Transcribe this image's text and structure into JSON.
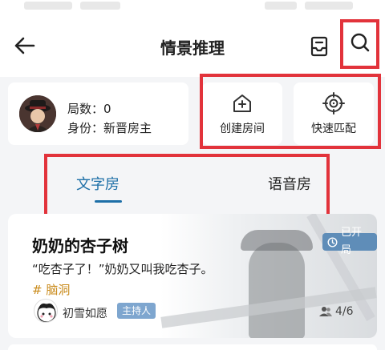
{
  "header": {
    "title": "情景推理"
  },
  "player": {
    "games_label": "局数：",
    "games_value": "0",
    "title_label": "身份：",
    "title_value": "新晋房主"
  },
  "actions": {
    "create_room": "创建房间",
    "quick_match": "快速匹配"
  },
  "tabs": [
    {
      "label": "文字房",
      "active": true
    },
    {
      "label": "语音房",
      "active": false
    }
  ],
  "room": {
    "title": "奶奶的杏子树",
    "status": "已开局",
    "description": "“吃杏子了！”奶奶又叫我吃杏子。",
    "tag": "# 脑洞",
    "host_name": "初雪如愿",
    "host_badge": "主持人",
    "players": "4/6"
  },
  "colors": {
    "accent": "#1d6fa7",
    "highlight": "#e2333b",
    "tag": "#c98a1a",
    "badge": "#5f8db8"
  },
  "icons": {
    "back": "arrow-left-icon",
    "inbox": "inbox-icon",
    "search": "search-icon",
    "create": "house-plus-icon",
    "match": "target-icon",
    "clock": "clock-icon",
    "players": "people-icon"
  }
}
